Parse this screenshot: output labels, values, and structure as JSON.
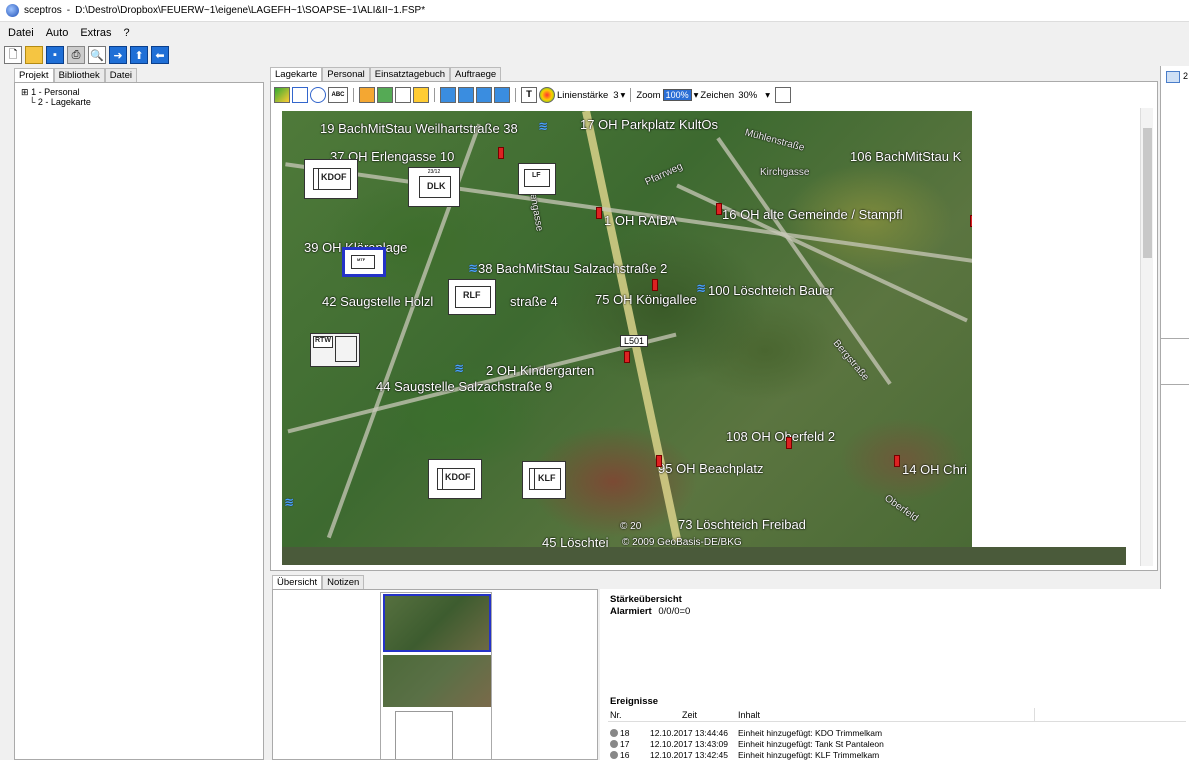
{
  "window": {
    "app_name": "sceptros",
    "title_path": "D:\\Destro\\Dropbox\\FEUERW~1\\eigene\\LAGEFH~1\\SOAPSE~1\\ALI&II~1.FSP*"
  },
  "menu": [
    "Datei",
    "Auto",
    "Extras",
    "?"
  ],
  "left": {
    "tabs": [
      "Projekt",
      "Bibliothek",
      "Datei"
    ],
    "tree": [
      "1 - Personal",
      "2 - Lagekarte"
    ]
  },
  "center": {
    "tabs": [
      "Lagekarte",
      "Personal",
      "Einsatztagebuch",
      "Auftraege"
    ],
    "toolbar": {
      "linienstaerke_label": "Linienstärke",
      "linienstaerke_value": "3",
      "zoom_label": "Zoom",
      "zoom_value": "100%",
      "zeichen_label": "Zeichen",
      "zeichen_value": "30%"
    }
  },
  "map": {
    "road_label": "L501",
    "places": [
      "19 BachMitStau Weilhartstraße 38",
      "17 OH Parkplatz KultOs",
      "106 BachMitStau K",
      "37 OH Erlengasse 10",
      "1 OH RAIBA",
      "16 OH alte Gemeinde / Stampfl",
      "39 OH Kläranlage",
      "38 BachMitStau Salzachstraße 2",
      "100 Löschteich Bauer",
      "42 Saugstelle Holzl",
      "straße 4",
      "75 OH Königallee",
      "2 OH Kindergarten",
      "44 Saugstelle Salzachstraße 9",
      "108 OH Oberfeld 2",
      "95 OH Beachplatz",
      "14 OH Chri",
      "73 Löschteich Freibad",
      "45 Löschtei"
    ],
    "street_names": [
      "Mühlenstraße",
      "Kirchgasse",
      "Pfarrweg",
      "Erlengasse",
      "Bergstraße",
      "Oberfeld"
    ],
    "copyright": "© 2009 GeoBasis-DE/BKG",
    "copyright2": "© 20",
    "units": {
      "kdof1": "KDOF",
      "dlk": "DLK",
      "dlk_top": "23/12",
      "lf": "LF",
      "mtf": "MTF",
      "rlf": "RLF",
      "rtw": "RTW",
      "kdof2": "KDOF",
      "klf": "KLF"
    }
  },
  "bottom": {
    "tabs": [
      "Übersicht",
      "Notizen"
    ],
    "staerke_title": "Stärkeübersicht",
    "alarmiert_label": "Alarmiert",
    "alarmiert_value": "0/0/0=0",
    "ereignisse_title": "Ereignisse",
    "columns": [
      "Nr.",
      "Zeit",
      "Inhalt"
    ],
    "events": [
      {
        "nr": "18",
        "zeit": "12.10.2017 13:44:46",
        "inhalt": "Einheit hinzugefügt: KDO Trimmelkam"
      },
      {
        "nr": "17",
        "zeit": "12.10.2017 13:43:09",
        "inhalt": "Einheit hinzugefügt: Tank St Pantaleon"
      },
      {
        "nr": "16",
        "zeit": "12.10.2017 13:42:45",
        "inhalt": "Einheit hinzugefügt: KLF Trimmelkam"
      }
    ]
  },
  "right": {
    "icon_label": "2"
  }
}
